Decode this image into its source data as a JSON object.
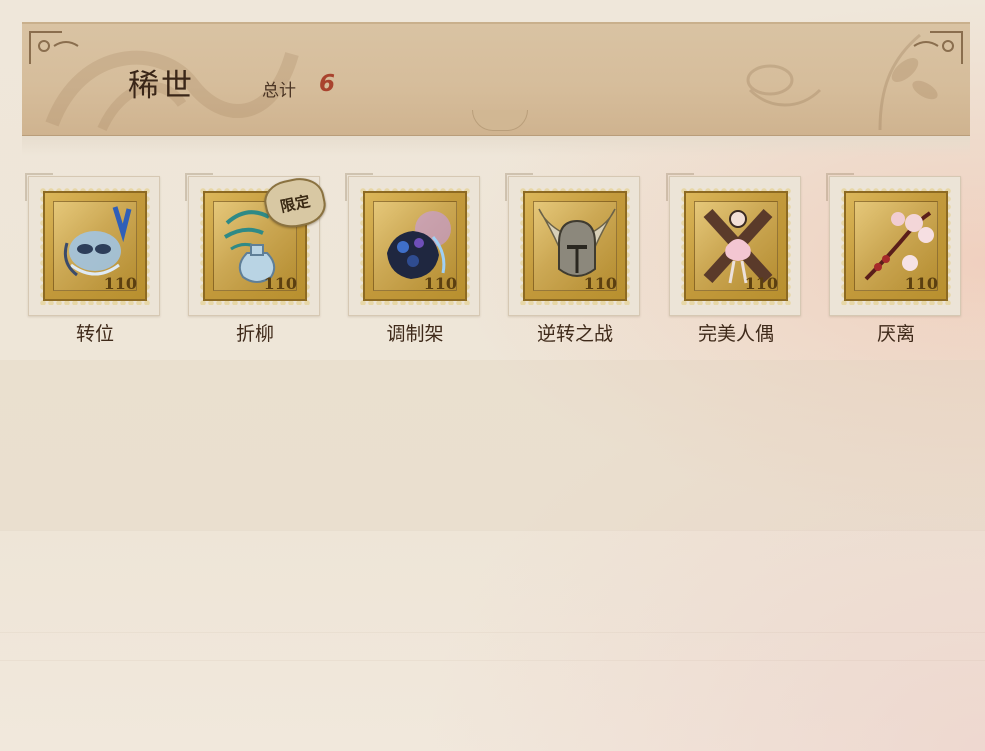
{
  "header": {
    "title": "稀世",
    "total_label": "总计",
    "total_value": "6"
  },
  "items": [
    {
      "name": "转位",
      "icon": "mask-icon",
      "stamp_value": "110",
      "badge": ""
    },
    {
      "name": "折柳",
      "icon": "vase-icon",
      "stamp_value": "110",
      "badge": "限定"
    },
    {
      "name": "调制架",
      "icon": "potion-rack-icon",
      "stamp_value": "110",
      "badge": ""
    },
    {
      "name": "逆转之战",
      "icon": "winged-helmet-icon",
      "stamp_value": "110",
      "badge": ""
    },
    {
      "name": "完美人偶",
      "icon": "doll-icon",
      "stamp_value": "110",
      "badge": ""
    },
    {
      "name": "厌离",
      "icon": "blossom-branch-icon",
      "stamp_value": "110",
      "badge": ""
    }
  ],
  "colors": {
    "stamp_gold": "#c39a3c",
    "total_value": "#a9432e",
    "header_bg": "#d6bd9b"
  }
}
